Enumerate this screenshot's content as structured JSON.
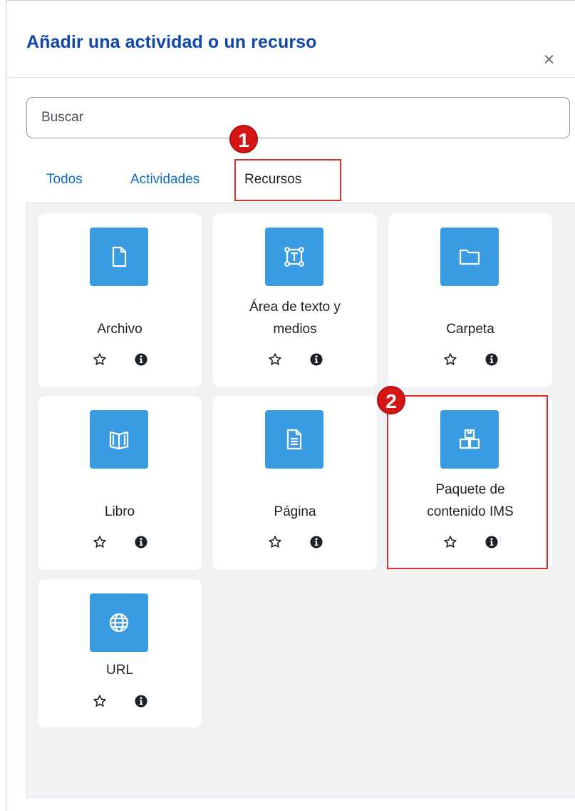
{
  "dialog": {
    "title": "Añadir una actividad o un recurso",
    "close_label": "×"
  },
  "search": {
    "placeholder": "Buscar"
  },
  "tabs": [
    {
      "label": "Todos",
      "active": false
    },
    {
      "label": "Actividades",
      "active": false
    },
    {
      "label": "Recursos",
      "active": true
    }
  ],
  "callouts": [
    {
      "number": "1",
      "target": "tab-recursos"
    },
    {
      "number": "2",
      "target": "card-paquete-ims"
    }
  ],
  "modules": [
    {
      "label_lines": [
        "Archivo"
      ],
      "icon": "file-icon"
    },
    {
      "label_lines": [
        "Área de texto y",
        "medios"
      ],
      "icon": "text-area-icon"
    },
    {
      "label_lines": [
        "Carpeta"
      ],
      "icon": "folder-icon"
    },
    {
      "label_lines": [
        "Libro"
      ],
      "icon": "book-icon"
    },
    {
      "label_lines": [
        "Página"
      ],
      "icon": "page-icon"
    },
    {
      "label_lines": [
        "Paquete de",
        "contenido IMS"
      ],
      "icon": "package-icon"
    },
    {
      "label_lines": [
        "URL"
      ],
      "icon": "globe-icon"
    }
  ],
  "colors": {
    "title": "#0f47ad",
    "tab_link": "#0f6cbf",
    "icon_bg": "#399be2",
    "callout": "#e02b2b",
    "badge": "#d41616"
  }
}
